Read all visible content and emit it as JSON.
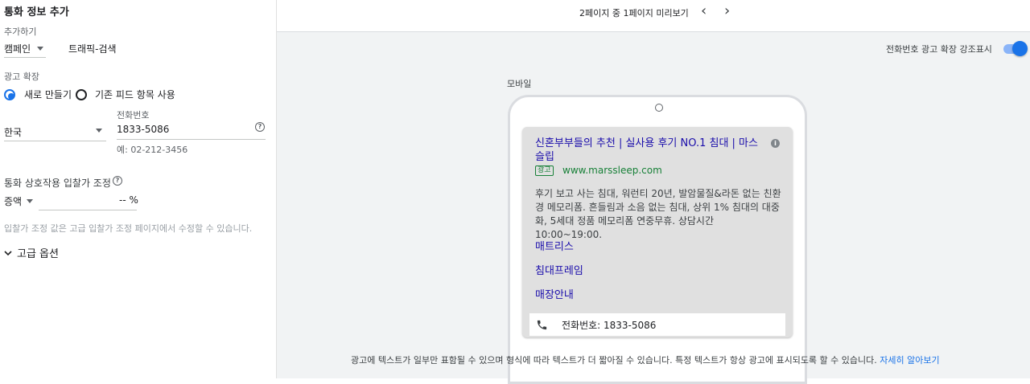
{
  "left": {
    "title": "통화 정보 추가",
    "add_to_label": "추가하기",
    "campaign_value": "캠페인",
    "campaign_name": "트래픽-검색",
    "extension_label": "광고 확장",
    "radio_new_label": "새로 만들기",
    "radio_existing_label": "기존 피드 항목 사용",
    "country_value": "한국",
    "phone_label": "전화번호",
    "phone_value": "1833-5086",
    "phone_hint": "예: 02-212-3456",
    "bid_label": "통화 상호작용 입찰가 조정",
    "bid_type_value": "증액",
    "bid_percent_value": "-- %",
    "bid_note": "입찰가 조정 값은 고급 입찰가 조정 페이지에서 수정할 수 있습니다.",
    "advanced_label": "고급 옵션"
  },
  "preview": {
    "pager_text": "2페이지 중 1페이지 미리보기",
    "prev_glyph": "‹",
    "next_glyph": "›",
    "toggle_label": "전화번호 광고 확장 강조표시",
    "device_label": "모바일",
    "ad": {
      "headline": "신혼부부들의 추천 | 실사용 후기 NO.1 침대 | 마스 슬립",
      "badge": "광고",
      "url": "www.marssleep.com",
      "description": "후기 보고 사는 침대, 워런티 20년, 발암물질&라돈 없는 친환경 메모리폼. 흔들림과 소음 없는 침대, 상위 1% 침대의 대중화, 5세대 정품 메모리폼 연중무휴. 상담시간 10:00~19:00.",
      "sitelinks": [
        "매트리스",
        "침대프레임",
        "매장안내"
      ],
      "call_text": "전화번호: 1833-5086"
    },
    "footer_text": "광고에 텍스트가 일부만 표함될 수 있으며 형식에 따라 텍스트가 더 짧아질 수 있습니다. 특정 텍스트가 항상 광고에 표시되도록 할 수 있습니다.",
    "footer_link": "자세히 알아보기"
  },
  "colors": {
    "accent": "#1a73e8",
    "link": "#1a0dab",
    "url_green": "#188038"
  }
}
